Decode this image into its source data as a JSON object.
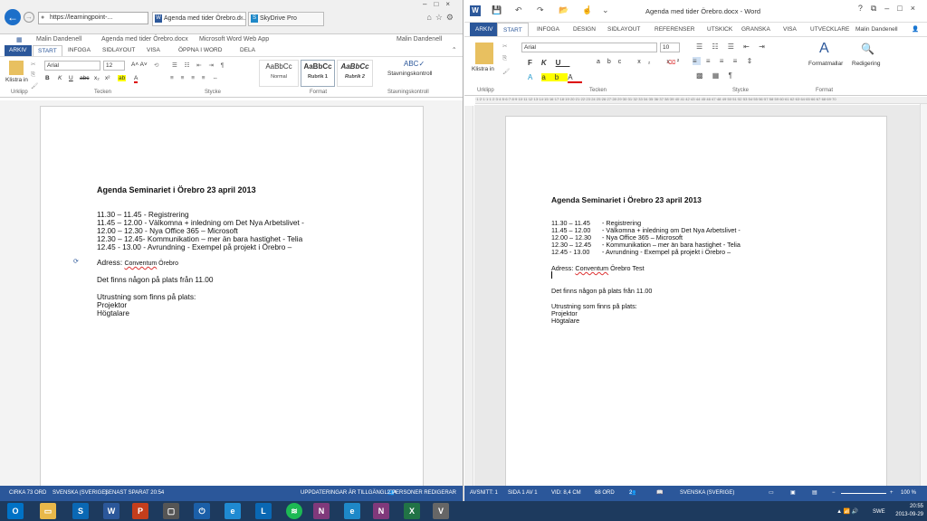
{
  "left": {
    "browser": {
      "url": "https://learningpoint-...",
      "tabs": [
        "Agenda med tider Örebro.d...",
        "SkyDrive Pro"
      ]
    },
    "wwa_header": {
      "user_left": "Malin Dandenell",
      "doc_name": "Agenda med tider Örebro.docx",
      "app_name": "Microsoft Word Web App",
      "user_right": "Malin Dandenell"
    },
    "ribbon_tabs": [
      "ARKIV",
      "START",
      "INFOGA",
      "SIDLAYOUT",
      "VISA",
      "ÖPPNA I WORD",
      "DELA"
    ],
    "ribbon": {
      "paste": "Klistra in",
      "font": "Arial",
      "size": "12",
      "groups": [
        "Urklipp",
        "Tecken",
        "Stycke",
        "Format",
        "Stavningskontroll"
      ],
      "styles": [
        {
          "sample": "AaBbCc",
          "name": "Normal"
        },
        {
          "sample": "AaBbCc",
          "name": "Rubrik 1"
        },
        {
          "sample": "AaBbCc",
          "name": "Rubrik 2"
        }
      ],
      "spell": "Stavningskontroll"
    },
    "status": {
      "words": "CIRKA 73 ORD",
      "lang": "SVENSKA (SVERIGE)",
      "saved": "SENAST SPARAT 20:54",
      "updates": "UPPDATERINGAR ÄR TILLGÄNGLIGA",
      "editors": "2 PERSONER REDIGERAR"
    }
  },
  "document": {
    "heading": "Agenda Seminariet i Örebro 23 april 2013",
    "left_lines": [
      "11.30 – 11.45 - Registrering",
      "11.45 – 12.00 - Välkomna + inledning om Det Nya Arbetslivet -",
      "12.00 – 12.30 - Nya Office 365 – Microsoft",
      "12.30 – 12.45- Kommunikation – mer än bara hastighet - Telia",
      "12.45 -  13.00  - Avrundning - Exempel på projekt i Örebro –"
    ],
    "right_times": [
      "11.30 – 11.45",
      "11.45 – 12.00",
      "12.00 – 12.30",
      "12.30 – 12.45",
      "12.45 -  13.00"
    ],
    "right_items": [
      "- Registrering",
      "- Välkomna + inledning om Det Nya Arbetslivet -",
      "- Nya Office 365 – Microsoft",
      "- Kommunikation – mer än bara hastighet - Telia",
      "- Avrundning - Exempel på projekt i Örebro –"
    ],
    "address_label": "Adress: ",
    "address_place": "Conventum",
    "address_city": " Örebro",
    "address_extra": " Test",
    "coffee": "Det finns någon på plats från 11.00",
    "equip_title": "Utrustning som finns på plats:",
    "equip_items": [
      "Projektor",
      "Högtalare"
    ]
  },
  "right": {
    "title": "Agenda med tider Örebro.docx - Word",
    "user": "Malin Dandenell",
    "tabs": [
      "ARKIV",
      "START",
      "INFOGA",
      "DESIGN",
      "SIDLAYOUT",
      "REFERENSER",
      "UTSKICK",
      "GRANSKA",
      "VISA",
      "UTVECKLARE"
    ],
    "ribbon": {
      "paste": "Klistra in",
      "font": "Arial",
      "size": "10",
      "groups": [
        "Urklipp",
        "Tecken",
        "Stycke",
        "Format",
        "Redigering"
      ],
      "format_btn": "Formatmallar",
      "edit_btn": "Redigering"
    },
    "status": {
      "section": "AVSNITT: 1",
      "page": "SIDA 1 AV 1",
      "pos": "VID: 8,4 CM",
      "words": "68 ORD",
      "authors": "2",
      "lang": "SVENSKA (SVERIGE)",
      "zoom": "100 %"
    }
  },
  "taskbar": {
    "time": "20:55",
    "date": "2013-09-29",
    "lang": "SWE"
  }
}
